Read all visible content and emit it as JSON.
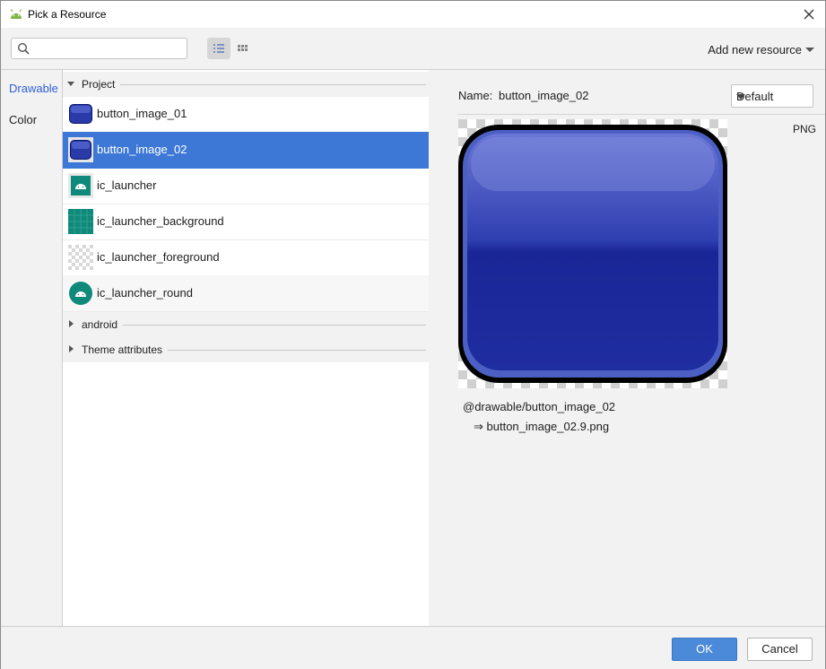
{
  "window": {
    "title": "Pick a Resource"
  },
  "toolbar": {
    "search_placeholder": "",
    "add_new_label": "Add new resource"
  },
  "sidebar": {
    "items": [
      {
        "label": "Drawable",
        "active": true
      },
      {
        "label": "Color",
        "active": false
      }
    ]
  },
  "sections": {
    "project": "Project",
    "android": "android",
    "theme": "Theme attributes"
  },
  "resources": [
    {
      "name": "button_image_01",
      "icon": "blue-button-thumbnail",
      "selected": false
    },
    {
      "name": "button_image_02",
      "icon": "blue-button-thumbnail",
      "selected": true
    },
    {
      "name": "ic_launcher",
      "icon": "android-launcher-thumbnail",
      "selected": false
    },
    {
      "name": "ic_launcher_background",
      "icon": "teal-grid-thumbnail",
      "selected": false
    },
    {
      "name": "ic_launcher_foreground",
      "icon": "transparent-thumbnail",
      "selected": false
    },
    {
      "name": "ic_launcher_round",
      "icon": "android-round-thumbnail",
      "selected": false
    }
  ],
  "preview": {
    "name_label": "Name:",
    "name_value": "button_image_02",
    "config_selected": "Default",
    "format": "PNG",
    "reference": "@drawable/button_image_02",
    "file": "⇒ button_image_02.9.png"
  },
  "footer": {
    "ok_label": "OK",
    "cancel_label": "Cancel"
  },
  "colors": {
    "selection": "#3d78d6",
    "accent_text": "#2f5fd7",
    "button_blue": "#1e2f9e",
    "teal": "#0f8a7a"
  }
}
